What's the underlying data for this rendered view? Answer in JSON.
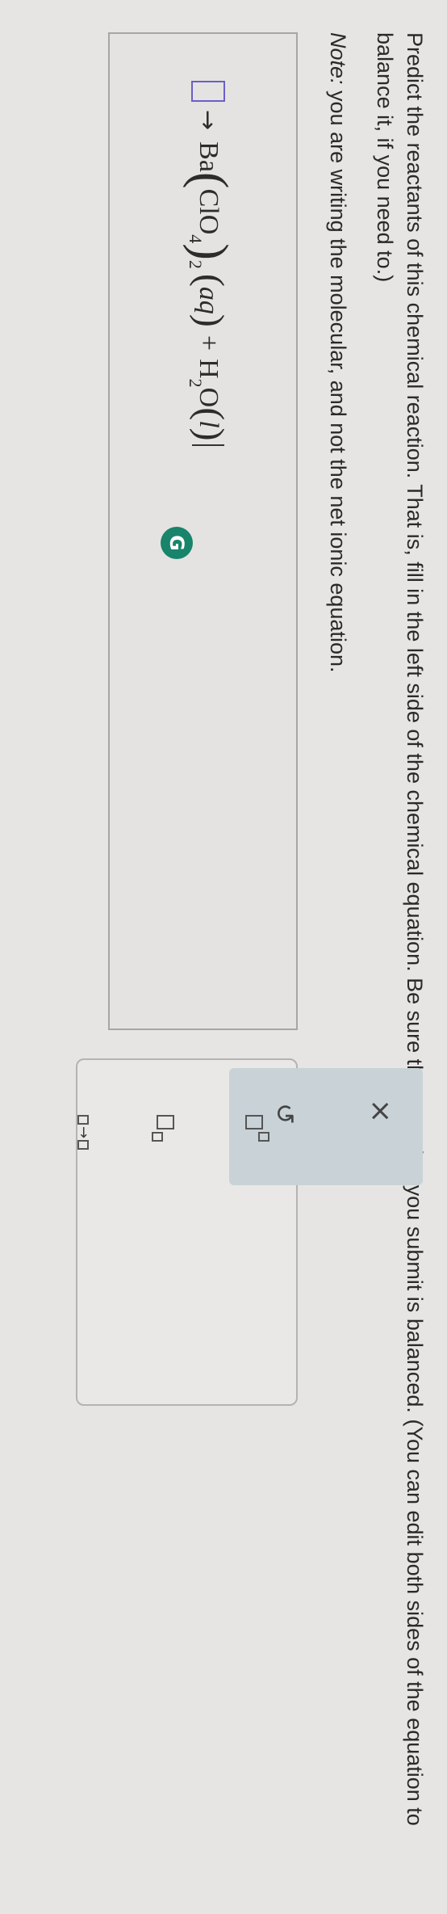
{
  "question": {
    "prompt": "Predict the reactants of this chemical reaction. That is, fill in the left side of the chemical equation. Be sure the equation you submit is balanced. (You can edit both sides of the equation to balance it, if you need to.)",
    "note_label": "Note:",
    "note_text": " you are writing the molecular, and not the net ionic equation."
  },
  "equation": {
    "arrow": "→",
    "product1_element": "Ba",
    "product1_group": "ClO",
    "product1_sub_inner": "4",
    "product1_sub_outer": "2",
    "product1_state": "aq",
    "plus": "+",
    "product2_h": "H",
    "product2_h_sub": "2",
    "product2_o": "O",
    "product2_state": "l"
  },
  "grammar_badge": {
    "letter": "G"
  },
  "toolbar": {
    "clear_label": "×",
    "undo_label": "↺",
    "icons": [
      "superscript-icon",
      "subscript-icon",
      "reaction-arrow-icon"
    ]
  },
  "colors": {
    "slot_border": "#6b5fc7",
    "grammar_badge": "#17846b",
    "action_panel": "#c9d2d7"
  }
}
